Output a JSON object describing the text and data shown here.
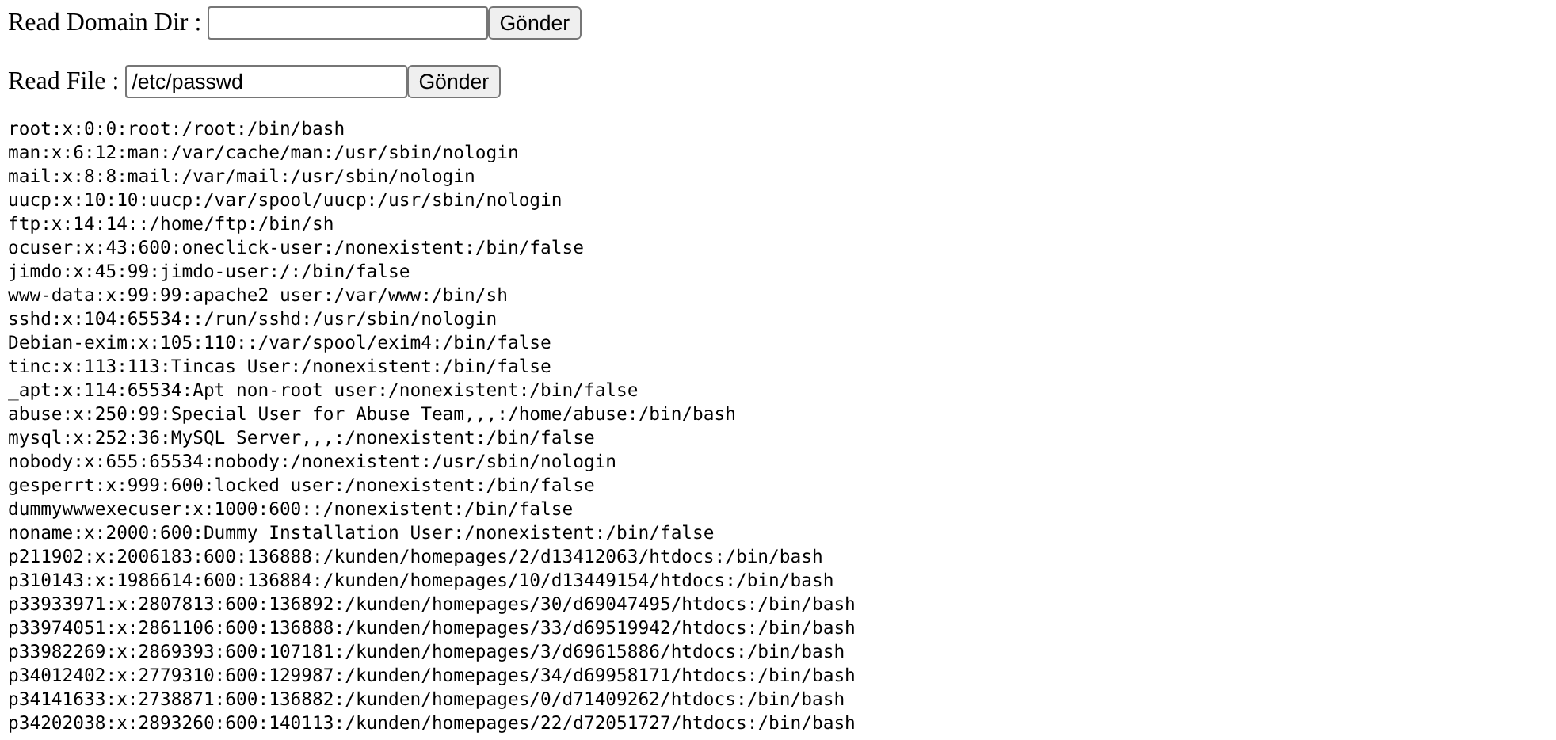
{
  "forms": [
    {
      "label": "Read Domain Dir :",
      "button": "Gönder"
    },
    {
      "label": "Read File :",
      "value": "/etc/passwd",
      "button": "Gönder"
    }
  ],
  "output_lines": [
    "root:x:0:0:root:/root:/bin/bash",
    "man:x:6:12:man:/var/cache/man:/usr/sbin/nologin",
    "mail:x:8:8:mail:/var/mail:/usr/sbin/nologin",
    "uucp:x:10:10:uucp:/var/spool/uucp:/usr/sbin/nologin",
    "ftp:x:14:14::/home/ftp:/bin/sh",
    "ocuser:x:43:600:oneclick-user:/nonexistent:/bin/false",
    "jimdo:x:45:99:jimdo-user:/:/bin/false",
    "www-data:x:99:99:apache2 user:/var/www:/bin/sh",
    "sshd:x:104:65534::/run/sshd:/usr/sbin/nologin",
    "Debian-exim:x:105:110::/var/spool/exim4:/bin/false",
    "tinc:x:113:113:Tincas User:/nonexistent:/bin/false",
    "_apt:x:114:65534:Apt non-root user:/nonexistent:/bin/false",
    "abuse:x:250:99:Special User for Abuse Team,,,:/home/abuse:/bin/bash",
    "mysql:x:252:36:MySQL Server,,,:/nonexistent:/bin/false",
    "nobody:x:655:65534:nobody:/nonexistent:/usr/sbin/nologin",
    "gesperrt:x:999:600:locked user:/nonexistent:/bin/false",
    "dummywwwexecuser:x:1000:600::/nonexistent:/bin/false",
    "noname:x:2000:600:Dummy Installation User:/nonexistent:/bin/false",
    "p211902:x:2006183:600:136888:/kunden/homepages/2/d13412063/htdocs:/bin/bash",
    "p310143:x:1986614:600:136884:/kunden/homepages/10/d13449154/htdocs:/bin/bash",
    "p33933971:x:2807813:600:136892:/kunden/homepages/30/d69047495/htdocs:/bin/bash",
    "p33974051:x:2861106:600:136888:/kunden/homepages/33/d69519942/htdocs:/bin/bash",
    "p33982269:x:2869393:600:107181:/kunden/homepages/3/d69615886/htdocs:/bin/bash",
    "p34012402:x:2779310:600:129987:/kunden/homepages/34/d69958171/htdocs:/bin/bash",
    "p34141633:x:2738871:600:136882:/kunden/homepages/0/d71409262/htdocs:/bin/bash",
    "p34202038:x:2893260:600:140113:/kunden/homepages/22/d72051727/htdocs:/bin/bash"
  ]
}
